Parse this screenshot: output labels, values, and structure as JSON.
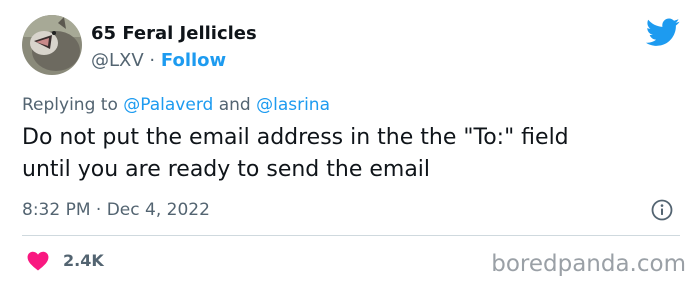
{
  "tweet": {
    "author_name": "65 Feral Jellicles",
    "handle": "@LXV",
    "separator": "·",
    "follow_label": "Follow",
    "replying_prefix": "Replying to",
    "reply_mention_1": "@Palaverd",
    "reply_conjunction": "and",
    "reply_mention_2": "@lasrina",
    "text_line_1": "Do not put the email address in the the \"To:\" field",
    "text_line_2": "until you are ready to send the email",
    "time": "8:32 PM",
    "date": "Dec 4, 2022",
    "like_count": "2.4K"
  },
  "watermark": "boredpanda.com",
  "icons": {
    "platform": "twitter-bird-icon",
    "info": "info-icon",
    "like": "heart-icon"
  },
  "colors": {
    "accent": "#1d9bf0",
    "like": "#f91880",
    "muted": "#536471",
    "text": "#0f1419"
  }
}
